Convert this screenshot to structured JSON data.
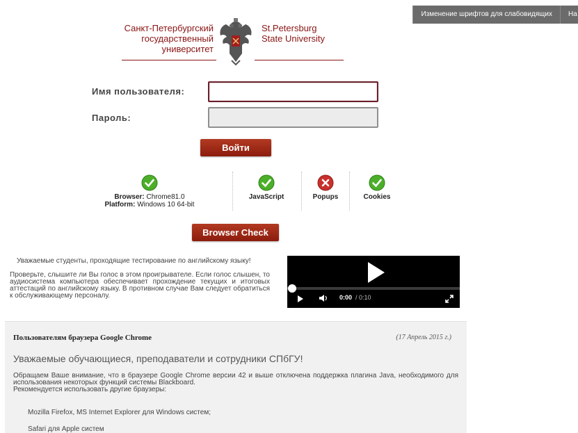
{
  "topbar": {
    "accessibility_label": "Изменение шрифтов для слабовидящих",
    "next_label": "На"
  },
  "logo": {
    "ru_line1": "Санкт-Петербургский",
    "ru_line2": "государственный",
    "ru_line3": "университет",
    "en_line1": "St.Petersburg",
    "en_line2": "State University"
  },
  "login": {
    "username_label": "Имя пользователя:",
    "username_value": "",
    "password_label": "Пароль:",
    "password_value": "",
    "submit_label": "Войти"
  },
  "browser_check": {
    "browser_label": "Browser:",
    "browser_value": "Chrome81.0",
    "platform_label": "Platform:",
    "platform_value": "Windows 10 64-bit",
    "javascript_label": "JavaScript",
    "popups_label": "Popups",
    "cookies_label": "Cookies",
    "button_label": "Browser Check",
    "colors": {
      "ok": "#4caf2a",
      "fail": "#c9302c"
    }
  },
  "notice": {
    "line1": "Уважаемые студенты, проходящие тестирование по английскому языку!",
    "line2": "Проверьте, слышите ли Вы голос в этом проигрывателе. Если голос слышен, то аудиосистема компьютера обеспечивает прохождение текущих и итоговых аттестаций по английскому языку. В противном случае Вам следует обратиться к обслуживающему персоналу."
  },
  "player": {
    "current_time": "0:00",
    "duration": "/ 0:10",
    "progress": 0
  },
  "announcement": {
    "title": "Пользователям браузера Google Chrome",
    "date": "(17 Апрель 2015 г.)",
    "heading": "Уважаемые обучающиеся, преподаватели и сотрудники СПбГУ!",
    "body1": "Обращаем Ваше внимание, что в браузере Google Chrome версии 42 и выше отключена поддержка плагина Java, необходимого для использования некоторых функций системы Blackboard.",
    "body2": "Рекомендуется использовать другие браузеры:",
    "items": [
      "Mozilla Firefox, MS Internet Explorer для Windows систем;",
      "Safari для Apple систем"
    ]
  }
}
